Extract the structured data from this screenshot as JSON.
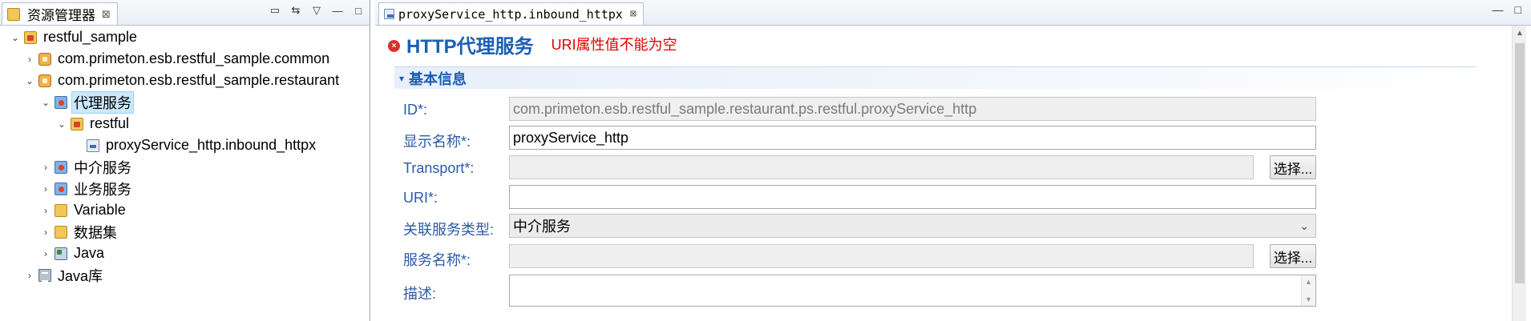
{
  "explorer": {
    "tab_label": "资源管理器",
    "tab_close": "⊠",
    "tools": [
      "▭",
      "⇆",
      "▽",
      "—",
      "□"
    ],
    "tree": [
      {
        "label": "restful_sample",
        "twisty": "⌄",
        "icon": "project-icon"
      },
      {
        "label": "com.primeton.esb.restful_sample.common",
        "twisty": "›",
        "icon": "package-icon"
      },
      {
        "label": "com.primeton.esb.restful_sample.restaurant",
        "twisty": "⌄",
        "icon": "package-icon"
      },
      {
        "label": "代理服务",
        "twisty": "⌄",
        "icon": "proxy-service-folder-icon"
      },
      {
        "label": "restful",
        "twisty": "⌄",
        "icon": "folder-icon"
      },
      {
        "label": "proxyService_http.inbound_httpx",
        "twisty": "",
        "icon": "service-file-icon"
      },
      {
        "label": "中介服务",
        "twisty": "›",
        "icon": "mediation-service-icon"
      },
      {
        "label": "业务服务",
        "twisty": "›",
        "icon": "business-service-icon"
      },
      {
        "label": "Variable",
        "twisty": "›",
        "icon": "variable-folder-icon"
      },
      {
        "label": "数据集",
        "twisty": "›",
        "icon": "dataset-folder-icon"
      },
      {
        "label": "Java",
        "twisty": "›",
        "icon": "java-icon"
      },
      {
        "label": "Java库",
        "twisty": "›",
        "icon": "java-library-icon"
      }
    ]
  },
  "editor": {
    "tab_label": "proxyService_http.inbound_httpx",
    "tab_close": "⊠",
    "window_tools": [
      "—",
      "□"
    ],
    "form_title": "HTTP代理服务",
    "form_error": "URI属性值不能为空",
    "error_icon": "×",
    "section_title": "基本信息",
    "section_toggle": "▾",
    "fields": {
      "id": {
        "label": "ID*:",
        "value": "com.primeton.esb.restful_sample.restaurant.ps.restful.proxyService_http"
      },
      "display_name": {
        "label": "显示名称*:",
        "value": "proxyService_http"
      },
      "transport": {
        "label": "Transport*:",
        "value": "",
        "button": "选择..."
      },
      "uri": {
        "label": "URI*:",
        "value": ""
      },
      "related_service_type": {
        "label": "关联服务类型:",
        "value": "中介服务",
        "arrow": "⌄"
      },
      "service_name": {
        "label": "服务名称*:",
        "value": "",
        "button": "选择..."
      },
      "description": {
        "label": "描述:",
        "value": ""
      }
    }
  },
  "colors": {
    "title_blue": "#1a5fb4",
    "error_red": "#e00000",
    "label_blue": "#2b5aa8",
    "selection_bg": "#cce8ff"
  }
}
